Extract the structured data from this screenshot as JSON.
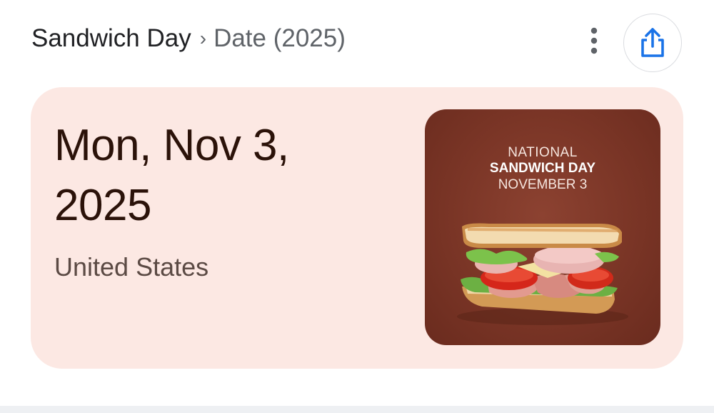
{
  "breadcrumb": {
    "title": "Sandwich Day",
    "separator": "›",
    "subtitle": "Date (2025)"
  },
  "actions": {
    "more_icon": "more-vert-icon",
    "share_icon": "share-icon",
    "share_color": "#1a73e8"
  },
  "card": {
    "background": "#fce8e3",
    "date": "Mon, Nov 3, 2025",
    "region": "United States",
    "image": {
      "line1": "NATIONAL",
      "line2": "SANDWICH DAY",
      "line3": "NOVEMBER 3"
    }
  }
}
